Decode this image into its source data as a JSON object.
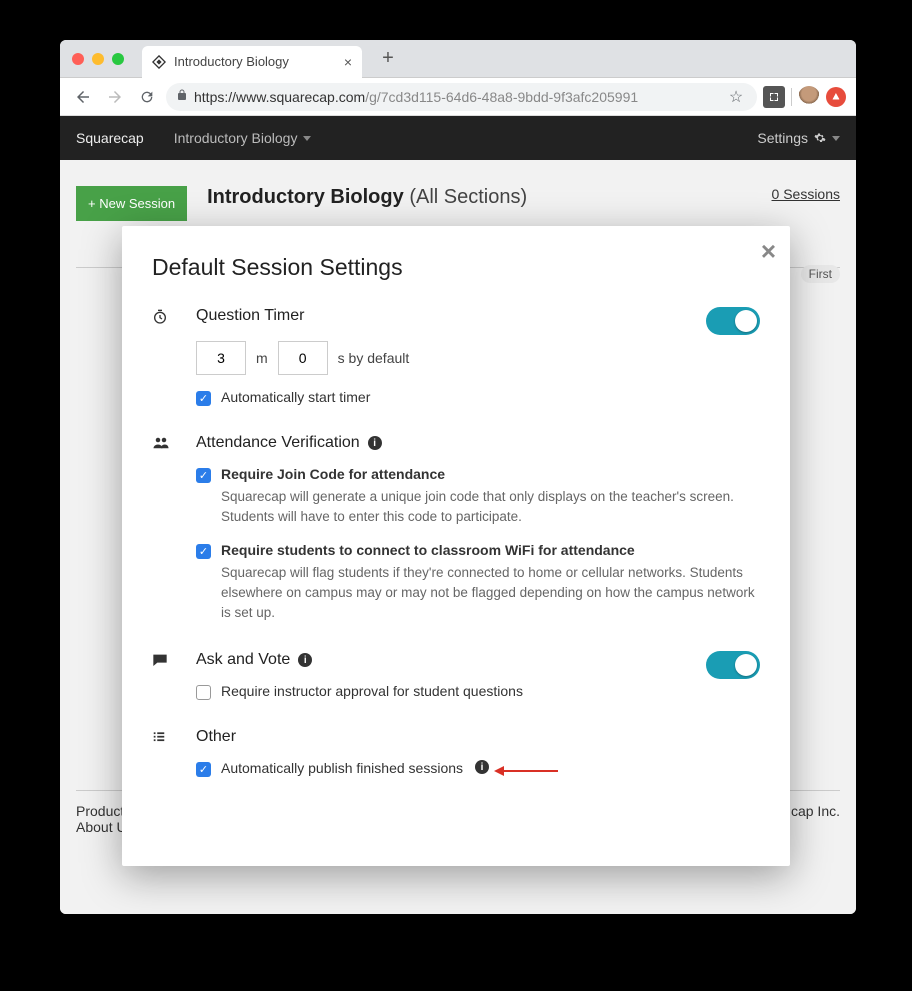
{
  "browser": {
    "tab_title": "Introductory Biology",
    "url_host": "https://www.squarecap.com",
    "url_path": "/g/7cd3d115-64d6-48a8-9bdd-9f3afc205991"
  },
  "appheader": {
    "brand": "Squarecap",
    "course": "Introductory Biology",
    "settings": "Settings"
  },
  "page": {
    "new_session_btn": "+ New Session",
    "title_bold": "Introductory Biology",
    "title_light": "(All Sections)",
    "sessions_link": "0 Sessions",
    "chip": "First",
    "footer_left1": "Product",
    "footer_left2": "About U",
    "footer_right": "cap Inc."
  },
  "modal": {
    "title": "Default Session Settings",
    "timer": {
      "title": "Question Timer",
      "minutes": "3",
      "seconds": "0",
      "m_label": "m",
      "s_label": "s by default",
      "auto_start": "Automatically start timer"
    },
    "attendance": {
      "title": "Attendance Verification",
      "join_code_title": "Require Join Code for attendance",
      "join_code_desc": "Squarecap will generate a unique join code that only displays on the teacher's screen. Students will have to enter this code to participate.",
      "wifi_title": "Require students to connect to classroom WiFi for attendance",
      "wifi_desc": "Squarecap will flag students if they're connected to home or cellular networks. Students elsewhere on campus may or may not be flagged depending on how the campus network is set up."
    },
    "askvote": {
      "title": "Ask and Vote",
      "approval": "Require instructor approval for student questions"
    },
    "other": {
      "title": "Other",
      "autopub": "Automatically publish finished sessions"
    }
  }
}
